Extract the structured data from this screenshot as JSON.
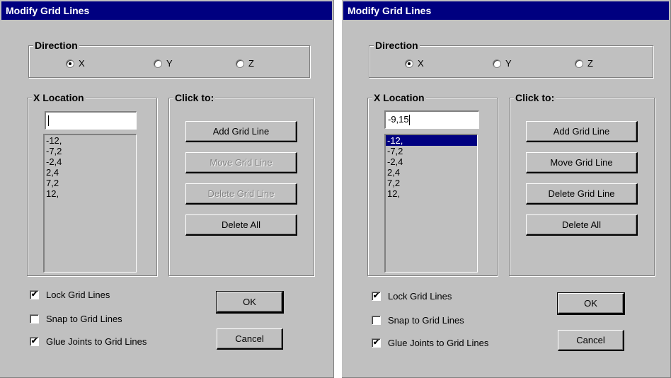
{
  "dialogs": [
    {
      "title": "Modify  Grid Lines",
      "direction": {
        "label": "Direction",
        "options": [
          "X",
          "Y",
          "Z"
        ],
        "selected": "X"
      },
      "location": {
        "label": "X Location",
        "input_value": "",
        "items": [
          "-12,",
          "-7,2",
          "-2,4",
          "2,4",
          "7,2",
          "12,"
        ],
        "selected_index": -1
      },
      "clickto": {
        "label": "Click to:",
        "add": "Add Grid Line",
        "move": "Move Grid Line",
        "delete": "Delete Grid Line",
        "delete_all": "Delete All"
      },
      "options": {
        "lock": "Lock Grid Lines",
        "snap": "Snap to Grid Lines",
        "glue": "Glue Joints to Grid Lines",
        "lock_checked": true,
        "snap_checked": false,
        "glue_checked": true
      },
      "ok": "OK",
      "cancel": "Cancel"
    },
    {
      "title": "Modify  Grid Lines",
      "direction": {
        "label": "Direction",
        "options": [
          "X",
          "Y",
          "Z"
        ],
        "selected": "X"
      },
      "location": {
        "label": "X Location",
        "input_value": "-9,15",
        "items": [
          "-12,",
          "-7,2",
          "-2,4",
          "2,4",
          "7,2",
          "12,"
        ],
        "selected_index": 0
      },
      "clickto": {
        "label": "Click to:",
        "add": "Add Grid Line",
        "move": "Move Grid Line",
        "delete": "Delete Grid Line",
        "delete_all": "Delete All"
      },
      "options": {
        "lock": "Lock Grid Lines",
        "snap": "Snap to Grid Lines",
        "glue": "Glue Joints to Grid Lines",
        "lock_checked": true,
        "snap_checked": false,
        "glue_checked": true
      },
      "ok": "OK",
      "cancel": "Cancel"
    }
  ],
  "colors": {
    "title_bar": "#000080",
    "face": "#c0c0c0",
    "selection": "#000080"
  }
}
